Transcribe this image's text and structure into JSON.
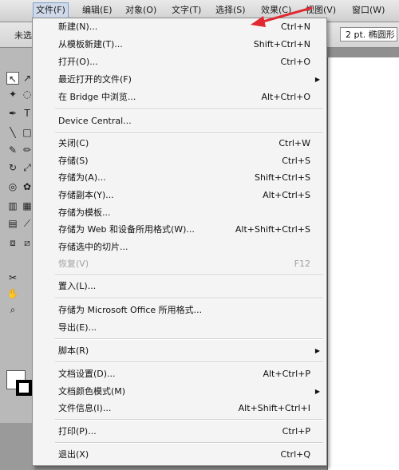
{
  "menubar": {
    "items": [
      "文件(F)",
      "编辑(E)",
      "对象(O)",
      "文字(T)",
      "选择(S)",
      "效果(C)",
      "视图(V)",
      "窗口(W)"
    ]
  },
  "controlbar": {
    "left_label": "未选",
    "stroke_field": "2 pt. 椭圆形"
  },
  "file_menu": {
    "items": [
      {
        "label": "新建(N)...",
        "shortcut": "Ctrl+N"
      },
      {
        "label": "从模板新建(T)...",
        "shortcut": "Shift+Ctrl+N"
      },
      {
        "label": "打开(O)...",
        "shortcut": "Ctrl+O"
      },
      {
        "label": "最近打开的文件(F)",
        "shortcut": "",
        "submenu": true
      },
      {
        "label": "在 Bridge 中浏览...",
        "shortcut": "Alt+Ctrl+O"
      },
      {
        "label": "Device Central...",
        "shortcut": ""
      },
      {
        "label": "关闭(C)",
        "shortcut": "Ctrl+W"
      },
      {
        "label": "存储(S)",
        "shortcut": "Ctrl+S"
      },
      {
        "label": "存储为(A)...",
        "shortcut": "Shift+Ctrl+S"
      },
      {
        "label": "存储副本(Y)...",
        "shortcut": "Alt+Ctrl+S"
      },
      {
        "label": "存储为模板...",
        "shortcut": ""
      },
      {
        "label": "存储为 Web 和设备所用格式(W)...",
        "shortcut": "Alt+Shift+Ctrl+S"
      },
      {
        "label": "存储选中的切片...",
        "shortcut": ""
      },
      {
        "label": "恢复(V)",
        "shortcut": "F12",
        "disabled": true
      },
      {
        "label": "置入(L)...",
        "shortcut": ""
      },
      {
        "label": "存储为 Microsoft Office 所用格式...",
        "shortcut": ""
      },
      {
        "label": "导出(E)...",
        "shortcut": ""
      },
      {
        "label": "脚本(R)",
        "shortcut": "",
        "submenu": true
      },
      {
        "label": "文档设置(D)...",
        "shortcut": "Alt+Ctrl+P"
      },
      {
        "label": "文档颜色模式(M)",
        "shortcut": "",
        "submenu": true
      },
      {
        "label": "文件信息(I)...",
        "shortcut": "Alt+Shift+Ctrl+I"
      },
      {
        "label": "打印(P)...",
        "shortcut": "Ctrl+P"
      },
      {
        "label": "退出(X)",
        "shortcut": "Ctrl+Q"
      }
    ]
  },
  "colors": {
    "annotation_arrow": "#e0282e",
    "menu_bg": "#f4f4f4",
    "active_menu_bg": "#cfd9ea"
  },
  "icons": {
    "submenu": "triangle-right",
    "tools": [
      "selection-icon",
      "direct-selection-icon",
      "magic-wand-icon",
      "lasso-icon",
      "pen-icon",
      "type-icon",
      "line-icon",
      "rectangle-icon",
      "paintbrush-icon",
      "pencil-icon",
      "rotate-icon",
      "scale-icon",
      "warp-icon",
      "symbol-sprayer-icon",
      "graph-icon",
      "mesh-icon",
      "gradient-icon",
      "eyedropper-icon",
      "blend-icon",
      "slice-icon",
      "scissors-icon",
      "hand-icon",
      "zoom-icon"
    ]
  }
}
